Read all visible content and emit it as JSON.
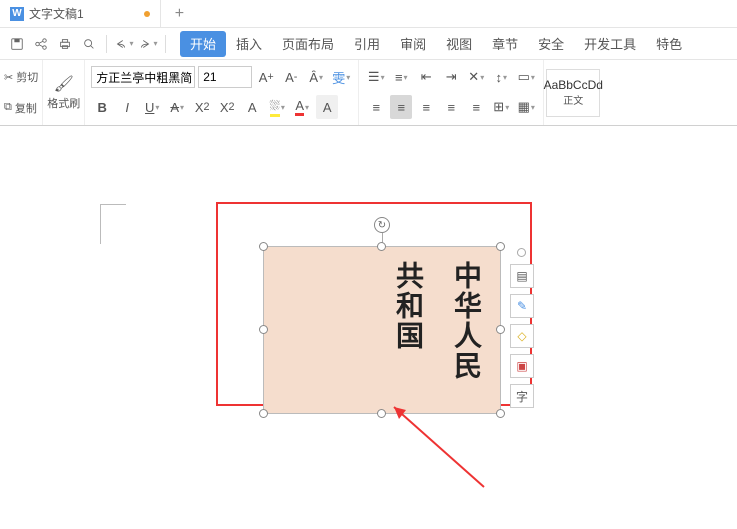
{
  "tab": {
    "title": "文字文稿1",
    "add": "+"
  },
  "menus": {
    "items": [
      "开始",
      "插入",
      "页面布局",
      "引用",
      "审阅",
      "视图",
      "章节",
      "安全",
      "开发工具",
      "特色"
    ],
    "active_index": 0
  },
  "side": {
    "cut": "剪切",
    "copy": "复制",
    "painter": "格式刷"
  },
  "font": {
    "name": "方正兰亭中粗黑简",
    "size": "21"
  },
  "style": {
    "sample": "AaBbCcDd",
    "label": "正文"
  },
  "textbox": {
    "line1": "中华人民",
    "line2": "共和国"
  },
  "float": {
    "font_char": "字"
  },
  "icons": {
    "brush": "✎"
  }
}
